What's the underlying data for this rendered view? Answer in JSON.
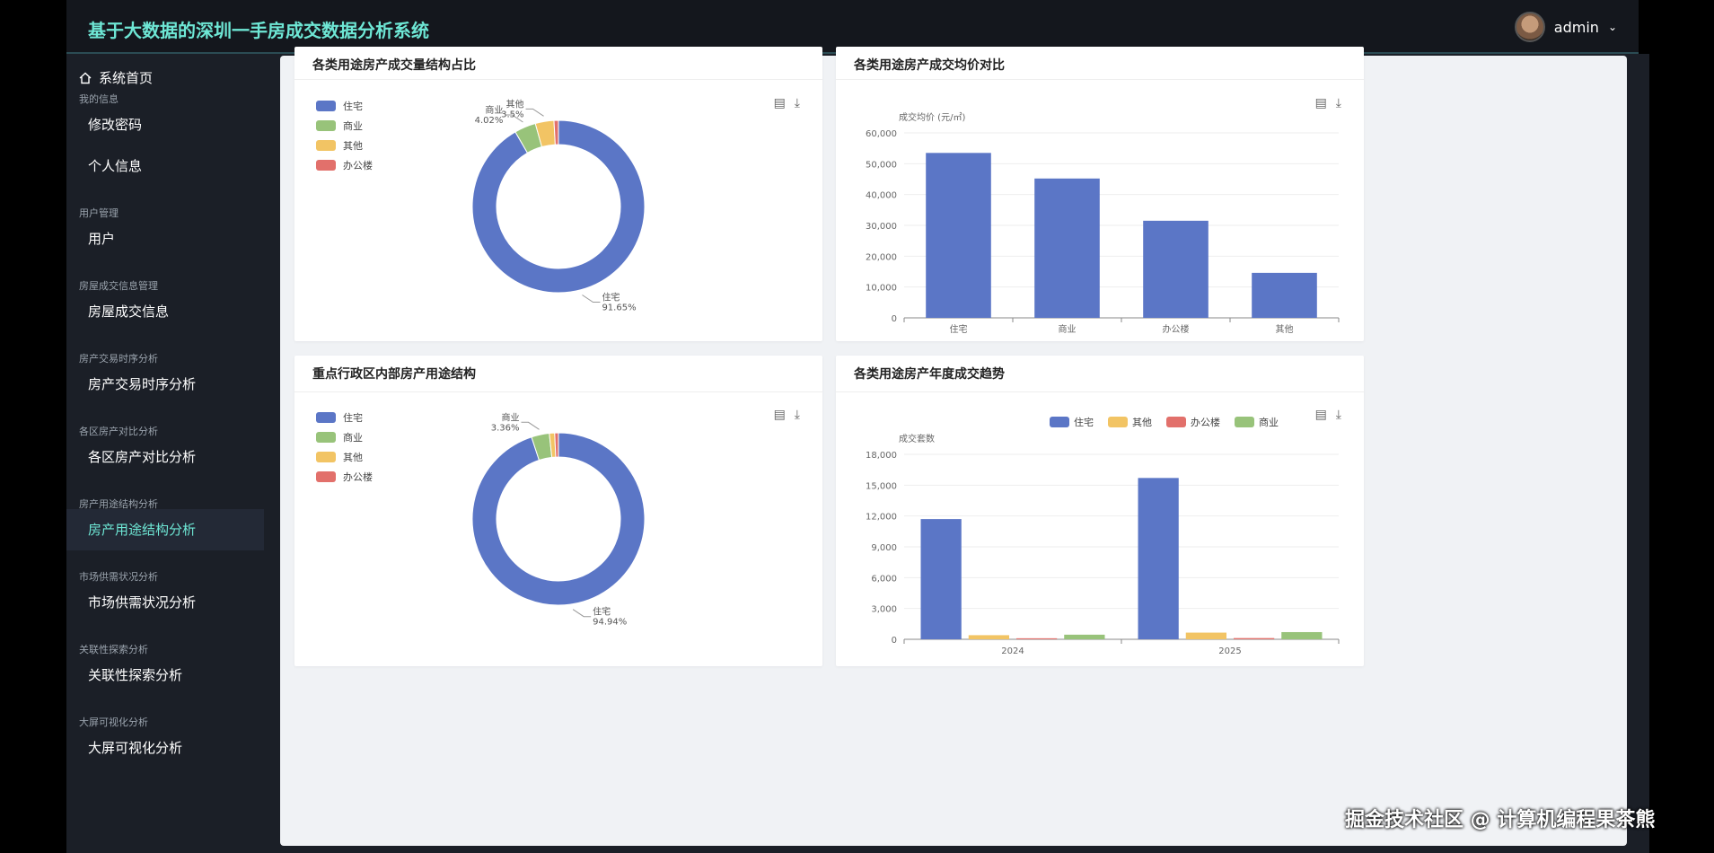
{
  "app": {
    "title": "基于大数据的深圳一手房成交数据分析系统",
    "user": "admin",
    "user_caret": "⌄"
  },
  "sidebar": {
    "home": "系统首页",
    "groups": [
      {
        "label": "我的信息",
        "items": [
          "修改密码",
          "个人信息"
        ]
      },
      {
        "label": "用户管理",
        "items": [
          "用户"
        ]
      },
      {
        "label": "房屋成交信息管理",
        "items": [
          "房屋成交信息"
        ]
      },
      {
        "label": "房产交易时序分析",
        "items": [
          "房产交易时序分析"
        ]
      },
      {
        "label": "各区房产对比分析",
        "items": [
          "各区房产对比分析"
        ]
      },
      {
        "label": "房产用途结构分析",
        "items": [
          "房产用途结构分析"
        ]
      },
      {
        "label": "市场供需状况分析",
        "items": [
          "市场供需状况分析"
        ]
      },
      {
        "label": "关联性探索分析",
        "items": [
          "关联性探索分析"
        ]
      },
      {
        "label": "大屏可视化分析",
        "items": [
          "大屏可视化分析"
        ]
      }
    ],
    "active": "房产用途结构分析"
  },
  "colors": {
    "blue": "#5b76c6",
    "green": "#98c37a",
    "yellow": "#f2c464",
    "red": "#e2706b",
    "accent": "#6ee7d5"
  },
  "cards": {
    "c1": {
      "title": "各类用途房产成交量结构占比"
    },
    "c2": {
      "title": "各类用途房产成交均价对比"
    },
    "c3": {
      "title": "重点行政区内部房产用途结构"
    },
    "c4": {
      "title": "各类用途房产年度成交趋势"
    }
  },
  "chart_data": [
    {
      "type": "pie",
      "title": "各类用途房产成交量结构占比",
      "legend": [
        "住宅",
        "商业",
        "其他",
        "办公楼"
      ],
      "slices": [
        {
          "name": "住宅",
          "value": 91.65,
          "label": "91.65%"
        },
        {
          "name": "商业",
          "value": 4.02,
          "label": "4.02%"
        },
        {
          "name": "其他",
          "value": 3.5,
          "label": "3.5%"
        },
        {
          "name": "办公楼",
          "value": 0.83
        }
      ]
    },
    {
      "type": "bar",
      "title": "各类用途房产成交均价对比",
      "ylabel": "成交均价 (元/㎡)",
      "categories": [
        "住宅",
        "商业",
        "办公楼",
        "其他"
      ],
      "values": [
        53500,
        45200,
        31500,
        14600
      ],
      "ylim": [
        0,
        60000
      ],
      "yticks": [
        "0",
        "10,000",
        "20,000",
        "30,000",
        "40,000",
        "50,000",
        "60,000"
      ]
    },
    {
      "type": "pie",
      "title": "重点行政区内部房产用途结构",
      "legend": [
        "住宅",
        "商业",
        "其他",
        "办公楼"
      ],
      "slices": [
        {
          "name": "住宅",
          "value": 94.94,
          "label": "94.94%"
        },
        {
          "name": "商业",
          "value": 3.36,
          "label": "3.36%"
        },
        {
          "name": "其他",
          "value": 1.0
        },
        {
          "name": "办公楼",
          "value": 0.7
        }
      ]
    },
    {
      "type": "bar",
      "title": "各类用途房产年度成交趋势",
      "ylabel": "成交套数",
      "categories": [
        "2024",
        "2025"
      ],
      "series": [
        {
          "name": "住宅",
          "values": [
            11700,
            15700
          ]
        },
        {
          "name": "其他",
          "values": [
            400,
            650
          ]
        },
        {
          "name": "办公楼",
          "values": [
            100,
            120
          ]
        },
        {
          "name": "商业",
          "values": [
            450,
            700
          ]
        }
      ],
      "ylim": [
        0,
        18000
      ],
      "yticks": [
        "0",
        "3,000",
        "6,000",
        "9,000",
        "12,000",
        "15,000",
        "18,000"
      ],
      "legend_position": "top"
    }
  ],
  "watermark": "掘金技术社区 @ 计算机编程果茶熊"
}
